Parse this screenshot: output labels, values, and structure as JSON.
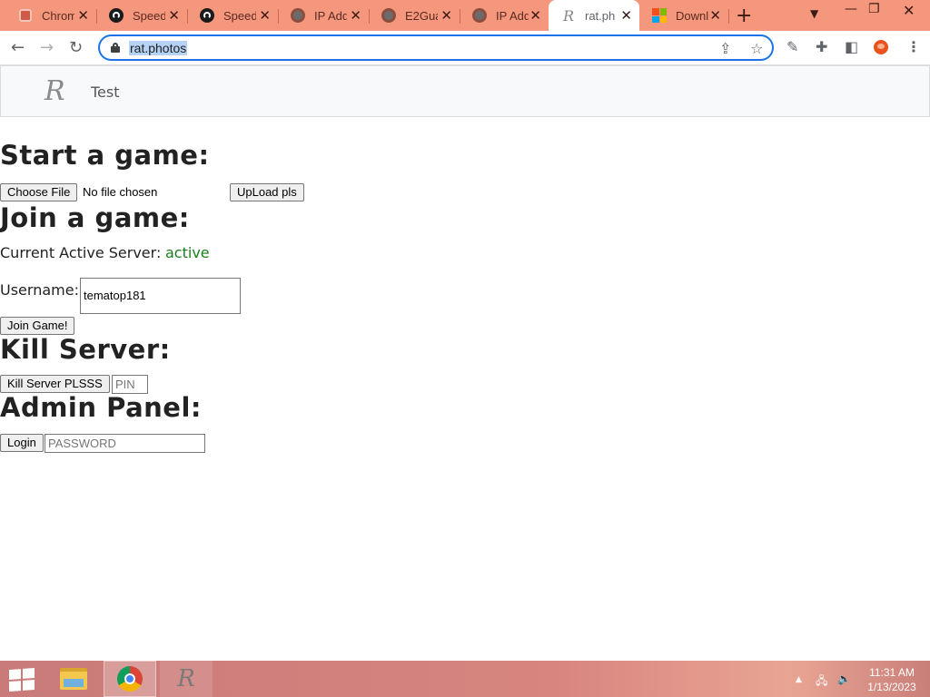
{
  "browser": {
    "tabs": [
      {
        "title": "Chrom",
        "favicon": "chrome-icon"
      },
      {
        "title": "Speed",
        "favicon": "speedtest-icon"
      },
      {
        "title": "Speed",
        "favicon": "speedtest-icon"
      },
      {
        "title": "IP Add",
        "favicon": "globe-icon"
      },
      {
        "title": "E2Gua",
        "favicon": "globe-icon"
      },
      {
        "title": "IP Add",
        "favicon": "globe-icon"
      },
      {
        "title": "rat.ph",
        "favicon": "rat-logo-icon",
        "active": true
      },
      {
        "title": "Downl",
        "favicon": "microsoft-icon"
      }
    ],
    "url": "rat.photos",
    "accent_color": "#1a73e8",
    "tabstrip_color": "#f4977d"
  },
  "site": {
    "brand_logo": "R",
    "brand_text": "Test"
  },
  "page": {
    "start_heading": "Start a game:",
    "choose_file_label": "Choose File",
    "no_file_text": "No file chosen",
    "upload_label": "UpLoad pls",
    "join_heading": "Join a game:",
    "server_label": "Current Active Server:",
    "server_status": "active",
    "username_label": "Username:",
    "username_value": "tematop181",
    "join_button": "Join Game!",
    "kill_heading": "Kill Server:",
    "kill_button": "Kill Server PLSSS",
    "pin_placeholder": "PIN",
    "admin_heading": "Admin Panel:",
    "login_button": "Login",
    "password_placeholder": "PASSWORD"
  },
  "taskbar": {
    "time": "11:31 AM",
    "date": "1/13/2023",
    "apps": [
      "file-explorer-icon",
      "chrome-icon",
      "rat-app-icon"
    ]
  }
}
